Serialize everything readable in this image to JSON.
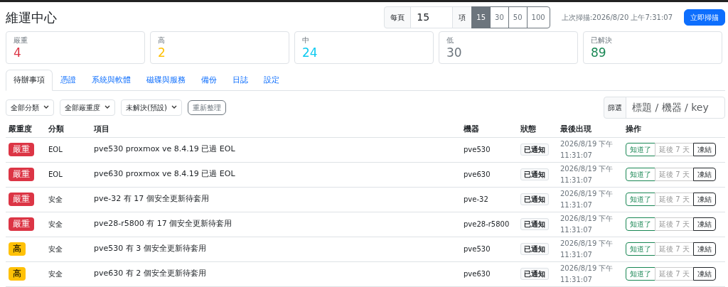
{
  "title": "維運中心",
  "page_size": {
    "label": "每頁",
    "value": "15",
    "unit": "項",
    "options": [
      {
        "label": "15",
        "selected": true
      },
      {
        "label": "30",
        "selected": false
      },
      {
        "label": "50",
        "selected": false
      },
      {
        "label": "100",
        "selected": false
      }
    ]
  },
  "last_scan": "上次掃描:2026/8/20 上午7:31:07",
  "scan_button": "立即掃描",
  "summary": [
    {
      "label": "嚴重",
      "value": "4",
      "kind": "critical"
    },
    {
      "label": "高",
      "value": "2",
      "kind": "high"
    },
    {
      "label": "中",
      "value": "24",
      "kind": "medium"
    },
    {
      "label": "低",
      "value": "30",
      "kind": "low"
    },
    {
      "label": "已解決",
      "value": "89",
      "kind": "resolved"
    }
  ],
  "tabs": [
    {
      "label": "待辦事項",
      "selected": true
    },
    {
      "label": "憑證",
      "selected": false
    },
    {
      "label": "系統與軟體",
      "selected": false
    },
    {
      "label": "磁碟與服務",
      "selected": false
    },
    {
      "label": "備份",
      "selected": false
    },
    {
      "label": "日誌",
      "selected": false
    },
    {
      "label": "設定",
      "selected": false
    }
  ],
  "filters": [
    {
      "label": "全部分類"
    },
    {
      "label": "全部嚴重度"
    },
    {
      "label": "未解決(預設)"
    }
  ],
  "refresh_button": "重新整理",
  "search": {
    "label": "篩選",
    "placeholder": "標題 / 機器 / key"
  },
  "table": {
    "columns": [
      "嚴重度",
      "分類",
      "項目",
      "機器",
      "狀態",
      "最後出現",
      "操作"
    ],
    "rows": [
      {
        "severity": {
          "label": "嚴重",
          "kind": "critical"
        },
        "category": "EOL",
        "item": "pve530 proxmox ve 8.4.19 已過 EOL",
        "machine": "pve530",
        "status": "已通知",
        "last_seen": "2026/8/19 下午 11:31:07",
        "actions": [
          {
            "label": "知道了",
            "kind": "ack"
          },
          {
            "label": "延後 7 天",
            "kind": "snooze"
          },
          {
            "label": "凍結",
            "kind": "freeze"
          }
        ]
      },
      {
        "severity": {
          "label": "嚴重",
          "kind": "critical"
        },
        "category": "EOL",
        "item": "pve630 proxmox ve 8.4.19 已過 EOL",
        "machine": "pve630",
        "status": "已通知",
        "last_seen": "2026/8/19 下午 11:31:07",
        "actions": [
          {
            "label": "知道了",
            "kind": "ack"
          },
          {
            "label": "延後 7 天",
            "kind": "snooze"
          },
          {
            "label": "凍結",
            "kind": "freeze"
          }
        ]
      },
      {
        "severity": {
          "label": "嚴重",
          "kind": "critical"
        },
        "category": "安全",
        "item": "pve-32 有 17 個安全更新待套用",
        "machine": "pve-32",
        "status": "已通知",
        "last_seen": "2026/8/19 下午 11:31:07",
        "actions": [
          {
            "label": "知道了",
            "kind": "ack"
          },
          {
            "label": "延後 7 天",
            "kind": "snooze"
          },
          {
            "label": "凍結",
            "kind": "freeze"
          }
        ]
      },
      {
        "severity": {
          "label": "嚴重",
          "kind": "critical"
        },
        "category": "安全",
        "item": "pve28-r5800 有 17 個安全更新待套用",
        "machine": "pve28-r5800",
        "status": "已通知",
        "last_seen": "2026/8/19 下午 11:31:07",
        "actions": [
          {
            "label": "知道了",
            "kind": "ack"
          },
          {
            "label": "延後 7 天",
            "kind": "snooze"
          },
          {
            "label": "凍結",
            "kind": "freeze"
          }
        ]
      },
      {
        "severity": {
          "label": "高",
          "kind": "high"
        },
        "category": "安全",
        "item": "pve530 有 3 個安全更新待套用",
        "machine": "pve530",
        "status": "已通知",
        "last_seen": "2026/8/19 下午 11:31:07",
        "actions": [
          {
            "label": "知道了",
            "kind": "ack"
          },
          {
            "label": "延後 7 天",
            "kind": "snooze"
          },
          {
            "label": "凍結",
            "kind": "freeze"
          }
        ]
      },
      {
        "severity": {
          "label": "高",
          "kind": "high"
        },
        "category": "安全",
        "item": "pve630 有 2 個安全更新待套用",
        "machine": "pve630",
        "status": "已通知",
        "last_seen": "2026/8/19 下午 11:31:07",
        "actions": [
          {
            "label": "知道了",
            "kind": "ack"
          },
          {
            "label": "延後 7 天",
            "kind": "snooze"
          },
          {
            "label": "凍結",
            "kind": "freeze"
          }
        ]
      }
    ]
  }
}
